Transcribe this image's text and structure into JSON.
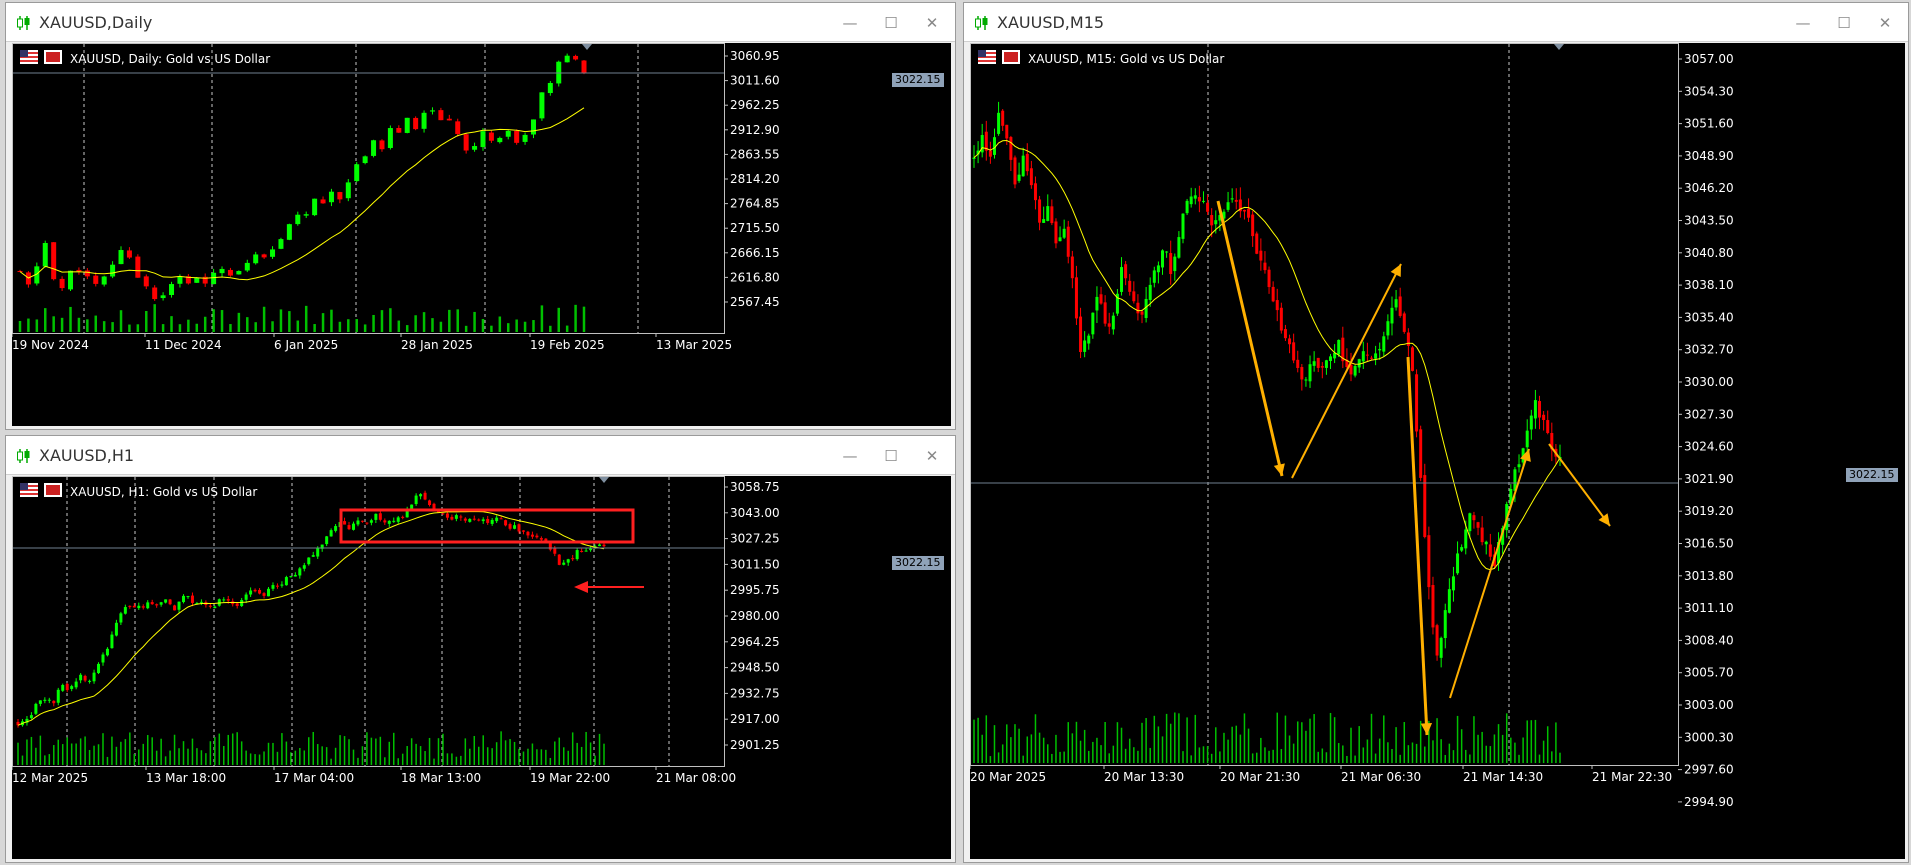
{
  "colors": {
    "bull": "#00ff00",
    "bear": "#ff0000",
    "ma": "#ffff00",
    "grid": "#c8c8c8",
    "price_line": "#708090",
    "volume": "#00c000",
    "annotation_red": "#ff2020",
    "annotation_orange": "#ffb000"
  },
  "window_controls": {
    "minimize": "—",
    "maximize": "☐",
    "close": "✕"
  },
  "windows": [
    {
      "id": "daily",
      "title": "XAUUSD,Daily",
      "label": "XAUUSD, Daily:  Gold vs US Dollar",
      "price_tag": "3022.15",
      "yticks": [
        "3060.95",
        "3011.60",
        "2962.25",
        "2912.90",
        "2863.55",
        "2814.20",
        "2764.85",
        "2715.50",
        "2666.15",
        "2616.80",
        "2567.45"
      ],
      "xticks": [
        "19 Nov 2024",
        "11 Dec 2024",
        "6 Jan 2025",
        "28 Jan 2025",
        "19 Feb 2025",
        "13 Mar 2025"
      ]
    },
    {
      "id": "h1",
      "title": "XAUUSD,H1",
      "label": "XAUUSD, H1:  Gold vs US Dollar",
      "price_tag": "3022.15",
      "yticks": [
        "3058.75",
        "3043.00",
        "3027.25",
        "3011.50",
        "2995.75",
        "2980.00",
        "2964.25",
        "2948.50",
        "2932.75",
        "2917.00",
        "2901.25"
      ],
      "xticks": [
        "12 Mar 2025",
        "13 Mar 18:00",
        "17 Mar 04:00",
        "18 Mar 13:00",
        "19 Mar 22:00",
        "21 Mar 08:00"
      ]
    },
    {
      "id": "m15",
      "title": "XAUUSD,M15",
      "label": "XAUUSD, M15:  Gold vs US Dollar",
      "price_tag": "3022.15",
      "yticks": [
        "3057.00",
        "3054.30",
        "3051.60",
        "3048.90",
        "3046.20",
        "3043.50",
        "3040.80",
        "3038.10",
        "3035.40",
        "3032.70",
        "3030.00",
        "3027.30",
        "3024.60",
        "3021.90",
        "3019.20",
        "3016.50",
        "3013.80",
        "3011.10",
        "3008.40",
        "3005.70",
        "3003.00",
        "3000.30",
        "2997.60",
        "2994.90"
      ],
      "xticks": [
        "20 Mar 2025",
        "20 Mar 13:30",
        "20 Mar 21:30",
        "21 Mar 06:30",
        "21 Mar 14:30",
        "21 Mar 22:30"
      ]
    }
  ],
  "chart_data": [
    {
      "type": "candlestick",
      "title": "XAUUSD, Daily:  Gold vs US Dollar",
      "ylim": [
        2540,
        3075
      ],
      "overlay": "moving average",
      "path": [
        2650,
        2625,
        2660,
        2705,
        2640,
        2620,
        2650,
        2655,
        2640,
        2625,
        2640,
        2665,
        2690,
        2680,
        2640,
        2625,
        2600,
        2610,
        2625,
        2640,
        2630,
        2640,
        2625,
        2650,
        2660,
        2645,
        2655,
        2665,
        2680,
        2675,
        2690,
        2710,
        2740,
        2760,
        2755,
        2790,
        2775,
        2800,
        2790,
        2820,
        2850,
        2870,
        2900,
        2880,
        2920,
        2910,
        2935,
        2920,
        2945,
        2955,
        2935,
        2930,
        2910,
        2880,
        2890,
        2915,
        2895,
        2905,
        2915,
        2890,
        2910,
        2935,
        2985,
        3005,
        3040,
        3055,
        3045,
        3022
      ]
    },
    {
      "type": "candlestick",
      "title": "XAUUSD, H1:  Gold vs US Dollar",
      "ylim": [
        2890,
        3065
      ],
      "overlay": "moving average",
      "path": [
        2915,
        2917,
        2925,
        2930,
        2928,
        2938,
        2935,
        2945,
        2940,
        2950,
        2958,
        2975,
        2985,
        2988,
        2985,
        2990,
        2988,
        2992,
        2985,
        2995,
        2990,
        2988,
        2985,
        2990,
        2990,
        2988,
        2995,
        2995,
        2993,
        2998,
        3000,
        3005,
        3008,
        3015,
        3020,
        3025,
        3035,
        3038,
        3035,
        3040,
        3036,
        3042,
        3038,
        3040,
        3042,
        3050,
        3055,
        3050,
        3045,
        3040,
        3042,
        3038,
        3042,
        3040,
        3038,
        3042,
        3035,
        3035,
        3030,
        3030,
        3027,
        3022,
        3010,
        3015,
        3020,
        3022,
        3024,
        3022
      ]
    },
    {
      "type": "candlestick",
      "title": "XAUUSD, M15:  Gold vs US Dollar",
      "ylim": [
        2993,
        3059
      ],
      "overlay": "moving average",
      "path": [
        3049,
        3051,
        3049,
        3053,
        3051,
        3047,
        3049,
        3047,
        3043,
        3045,
        3041,
        3043,
        3037,
        3031,
        3033,
        3037,
        3033,
        3035,
        3039,
        3037,
        3034,
        3036,
        3039,
        3041,
        3038,
        3043,
        3045,
        3046,
        3045,
        3043,
        3044,
        3046,
        3045,
        3044,
        3041,
        3039,
        3036,
        3034,
        3032,
        3030,
        3028,
        3031,
        3029,
        3030,
        3032,
        3030,
        3029,
        3031,
        3030,
        3031,
        3034,
        3036,
        3034,
        3030,
        3020,
        3010,
        3002,
        3006,
        3010,
        3013,
        3016,
        3015,
        3013,
        3011,
        3015,
        3018,
        3021,
        3024,
        3026,
        3025,
        3022,
        3021
      ]
    }
  ]
}
